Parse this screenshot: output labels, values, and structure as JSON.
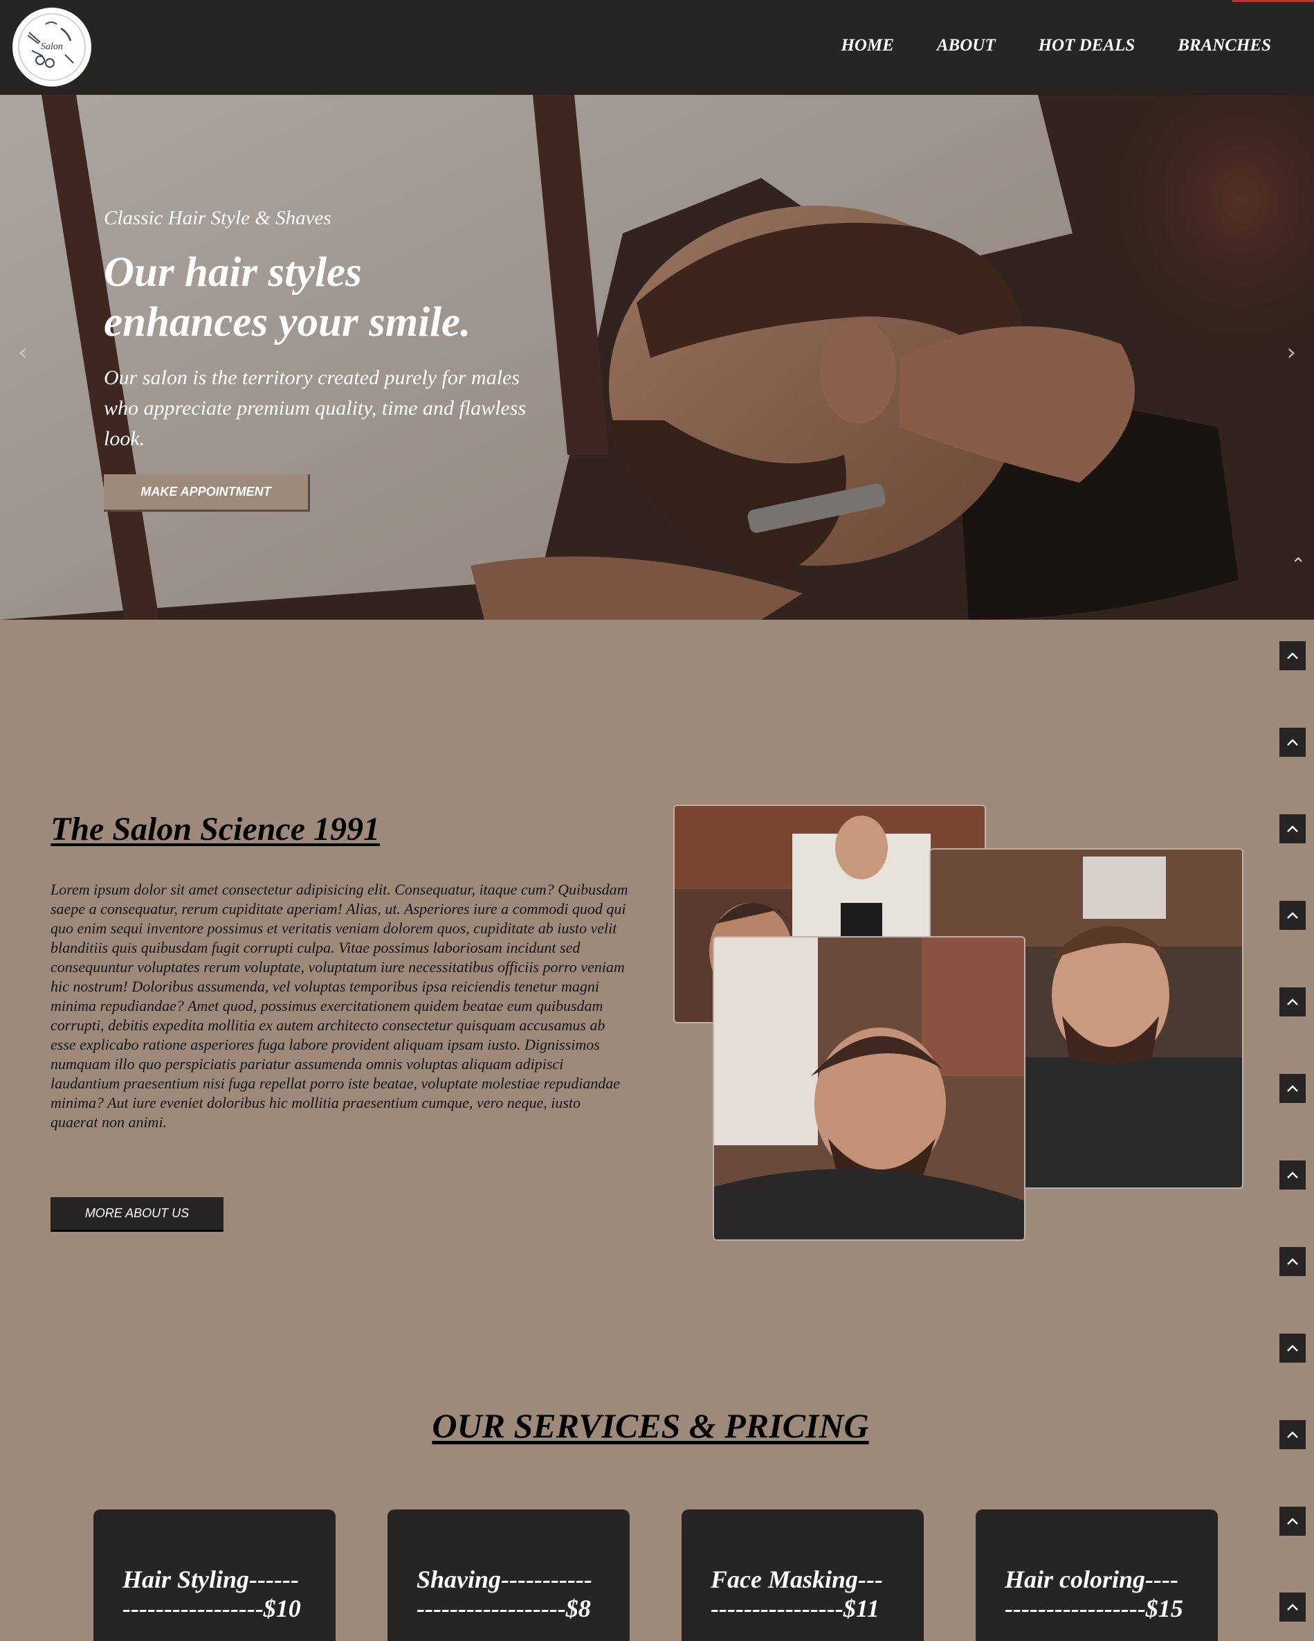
{
  "logo": {
    "text": "Salon"
  },
  "nav": {
    "items": [
      {
        "label": "HOME"
      },
      {
        "label": "ABOUT"
      },
      {
        "label": "HOT DEALS"
      },
      {
        "label": "BRANCHES"
      }
    ]
  },
  "hero": {
    "subtitle": "Classic Hair Style & Shaves",
    "title_line1": "Our hair styles",
    "title_line2": "enhances your smile.",
    "text": "Our salon is the territory created purely for males who appreciate premium quality, time and flawless look.",
    "button_label": "MAKE APPOINTMENT",
    "prev_icon": "chevron-left-icon",
    "next_icon": "chevron-right-icon"
  },
  "about": {
    "title": "The Salon Science 1991",
    "text": "Lorem ipsum dolor sit amet consectetur adipisicing elit. Consequatur, itaque cum? Quibusdam saepe a consequatur, rerum cupiditate aperiam! Alias, ut. Asperiores iure a commodi quod qui quo enim sequi inventore possimus et veritatis veniam dolorem quos, cupiditate ab iusto velit blanditiis quis quibusdam fugit corrupti culpa. Vitae possimus laboriosam incidunt sed consequuntur voluptates rerum voluptate, voluptatum iure necessitatibus officiis porro veniam hic nostrum! Doloribus assumenda, vel voluptas temporibus ipsa reiciendis tenetur magni minima repudiandae? Amet quod, possimus exercitationem quidem beatae eum quibusdam corrupti, debitis expedita mollitia ex autem architecto consectetur quisquam accusamus ab esse explicabo ratione asperiores fuga labore provident aliquam ipsam iusto. Dignissimos numquam illo quo perspiciatis pariatur assumenda omnis voluptas aliquam adipisci laudantium praesentium nisi fuga repellat porro iste beatae, voluptate molestiae repudiandae minima? Aut iure eveniet doloribus hic mollitia praesentium cumque, vero neque, iusto quaerat non animi.",
    "button_label": "MORE ABOUT US"
  },
  "services": {
    "title": "OUR SERVICES & PRICING",
    "items": [
      {
        "name": "Hair Styling------",
        "price": "-----------------$10"
      },
      {
        "name": "Shaving-----------",
        "price": "------------------$8"
      },
      {
        "name": "Face Masking---",
        "price": "----------------$11"
      },
      {
        "name": "Hair coloring----",
        "price": "-----------------$15"
      }
    ]
  },
  "colors": {
    "nav_bg": "#262524",
    "page_bg": "#9e8a7b",
    "accent": "#c0312b"
  },
  "scroll_icon": "chevron-up-icon"
}
